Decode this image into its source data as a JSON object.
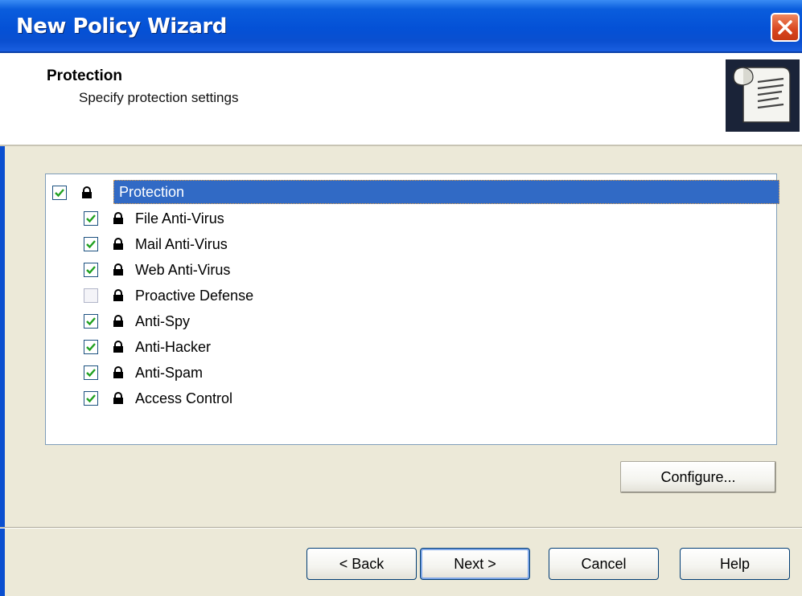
{
  "window": {
    "title": "New Policy Wizard"
  },
  "header": {
    "title": "Protection",
    "subtitle": "Specify protection settings"
  },
  "tree": {
    "root": {
      "label": "Protection",
      "checked": true,
      "selected": true
    },
    "items": [
      {
        "label": "File Anti-Virus",
        "checked": true
      },
      {
        "label": "Mail Anti-Virus",
        "checked": true
      },
      {
        "label": "Web Anti-Virus",
        "checked": true
      },
      {
        "label": "Proactive Defense",
        "checked": false
      },
      {
        "label": "Anti-Spy",
        "checked": true
      },
      {
        "label": "Anti-Hacker",
        "checked": true
      },
      {
        "label": "Anti-Spam",
        "checked": true
      },
      {
        "label": "Access Control",
        "checked": true
      }
    ]
  },
  "buttons": {
    "configure": "Configure...",
    "back": "< Back",
    "next": "Next >",
    "cancel": "Cancel",
    "help": "Help"
  },
  "colors": {
    "titlebar": "#0451d6",
    "selection": "#316ac5",
    "check": "#21a121"
  }
}
